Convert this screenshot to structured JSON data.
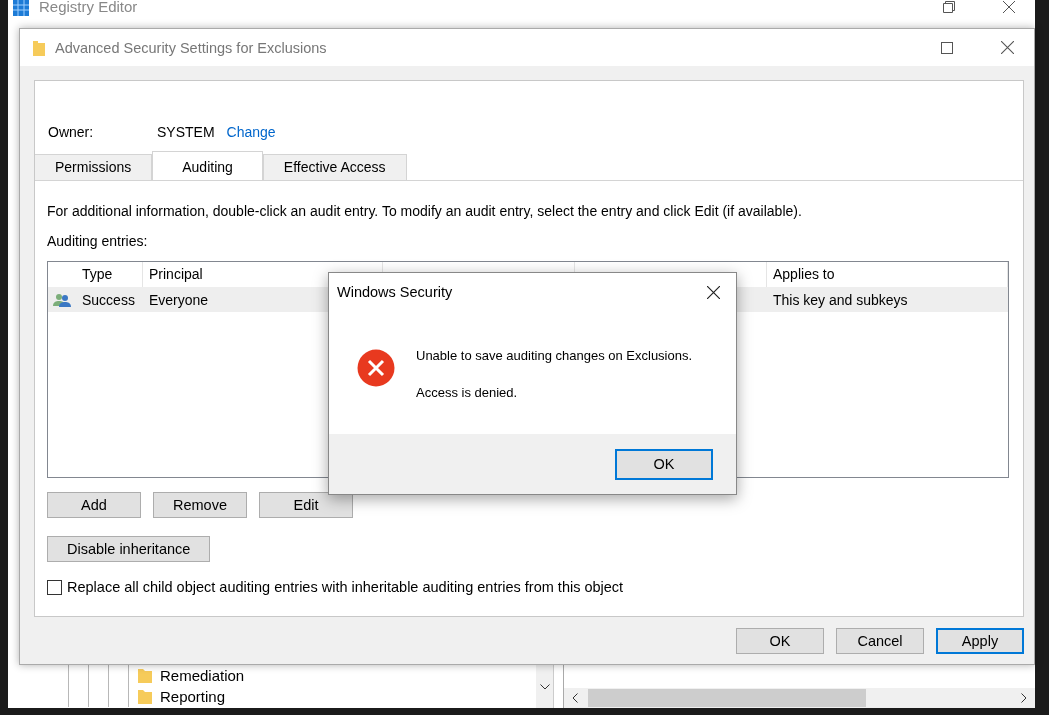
{
  "registry_window": {
    "title": "Registry Editor",
    "tree_items": [
      {
        "label": "Remediation"
      },
      {
        "label": "Reporting"
      }
    ]
  },
  "security_window": {
    "title": "Advanced Security Settings for Exclusions",
    "owner_label": "Owner:",
    "owner": "SYSTEM",
    "change_link": "Change",
    "tabs": [
      {
        "label": "Permissions",
        "selected": false
      },
      {
        "label": "Auditing",
        "selected": true
      },
      {
        "label": "Effective Access",
        "selected": false
      }
    ],
    "info": "For additional information, double-click an audit entry. To modify an audit entry, select the entry and click Edit (if available).",
    "entries_label": "Auditing entries:",
    "table": {
      "columns": {
        "type": "Type",
        "principal": "Principal",
        "applies_to": "Applies to"
      },
      "rows": [
        {
          "type": "Success",
          "principal": "Everyone",
          "applies_to": "This key and subkeys",
          "selected": true
        }
      ]
    },
    "entry_buttons": [
      "Add",
      "Remove",
      "Edit"
    ],
    "inheritance_button": "Disable inheritance",
    "replace_checkbox": {
      "label": "Replace all child object auditing entries with inheritable auditing entries from this object",
      "checked": false
    },
    "footer_buttons": [
      {
        "label": "OK",
        "focused": false
      },
      {
        "label": "Cancel",
        "focused": false
      },
      {
        "label": "Apply",
        "focused": true
      }
    ]
  },
  "error_dialog": {
    "title": "Windows Security",
    "message": "Unable to save auditing changes on Exclusions.",
    "detail": "Access is denied.",
    "button": {
      "label": "OK",
      "focused": true
    }
  }
}
